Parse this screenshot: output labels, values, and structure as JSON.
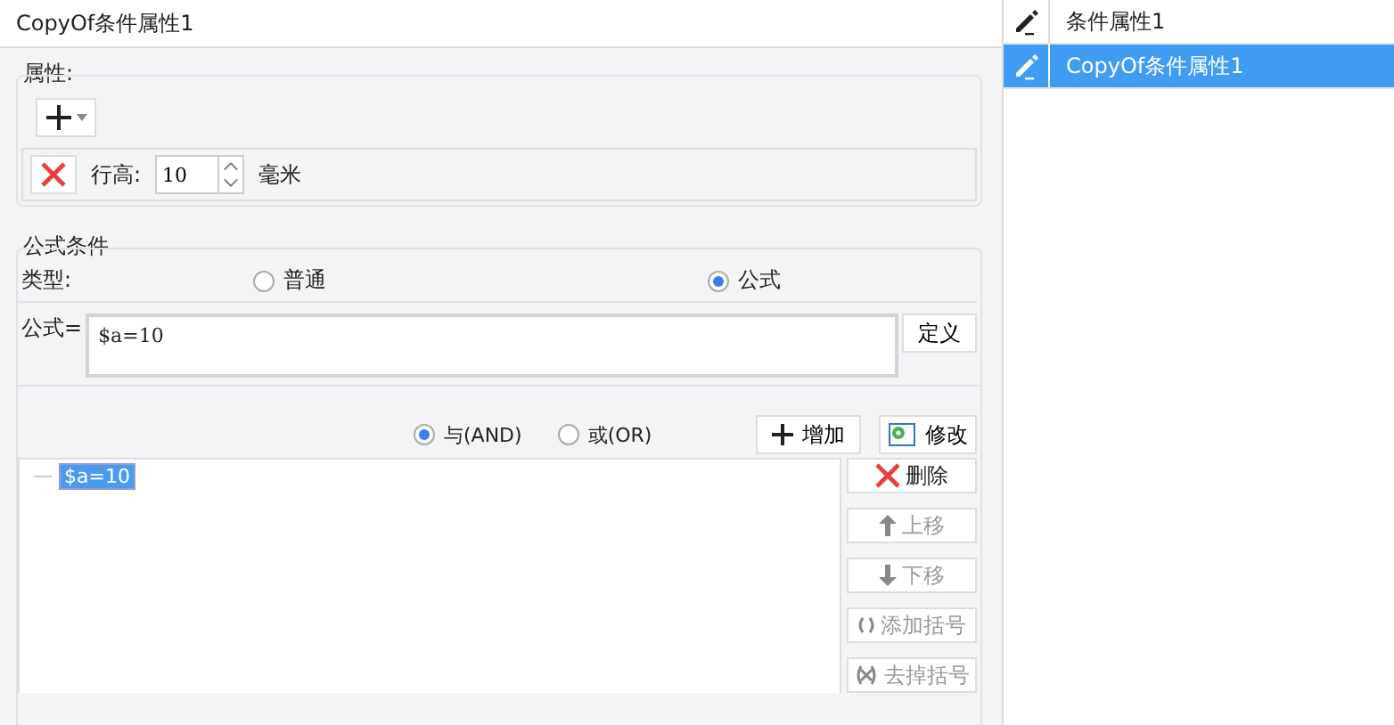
{
  "title": "CopyOf条件属性1",
  "attributes": {
    "legend": "属性:",
    "rows": [
      {
        "label": "行高:",
        "value": "10",
        "unit": "毫米"
      }
    ]
  },
  "formula_condition": {
    "legend": "公式条件",
    "type_label": "类型:",
    "types": [
      {
        "label": "普通",
        "selected": false
      },
      {
        "label": "公式",
        "selected": true
      }
    ],
    "formula_label": "公式=",
    "formula_value": "$a=10",
    "define_button": "定义",
    "logic": [
      {
        "label": "与(AND)",
        "selected": true
      },
      {
        "label": "或(OR)",
        "selected": false
      }
    ],
    "add_button": "增加",
    "modify_button": "修改",
    "conditions": [
      {
        "label": "$a=10",
        "selected": true
      }
    ],
    "actions": [
      {
        "kind": "delete",
        "label": "删除",
        "disabled": false
      },
      {
        "kind": "up",
        "label": "上移",
        "disabled": true
      },
      {
        "kind": "down",
        "label": "下移",
        "disabled": true
      },
      {
        "kind": "add-paren",
        "label": "添加括号",
        "disabled": true
      },
      {
        "kind": "remove-paren",
        "label": "去掉括号",
        "disabled": true
      }
    ]
  },
  "list": [
    {
      "label": "条件属性1",
      "selected": false
    },
    {
      "label": "CopyOf条件属性1",
      "selected": true
    }
  ]
}
